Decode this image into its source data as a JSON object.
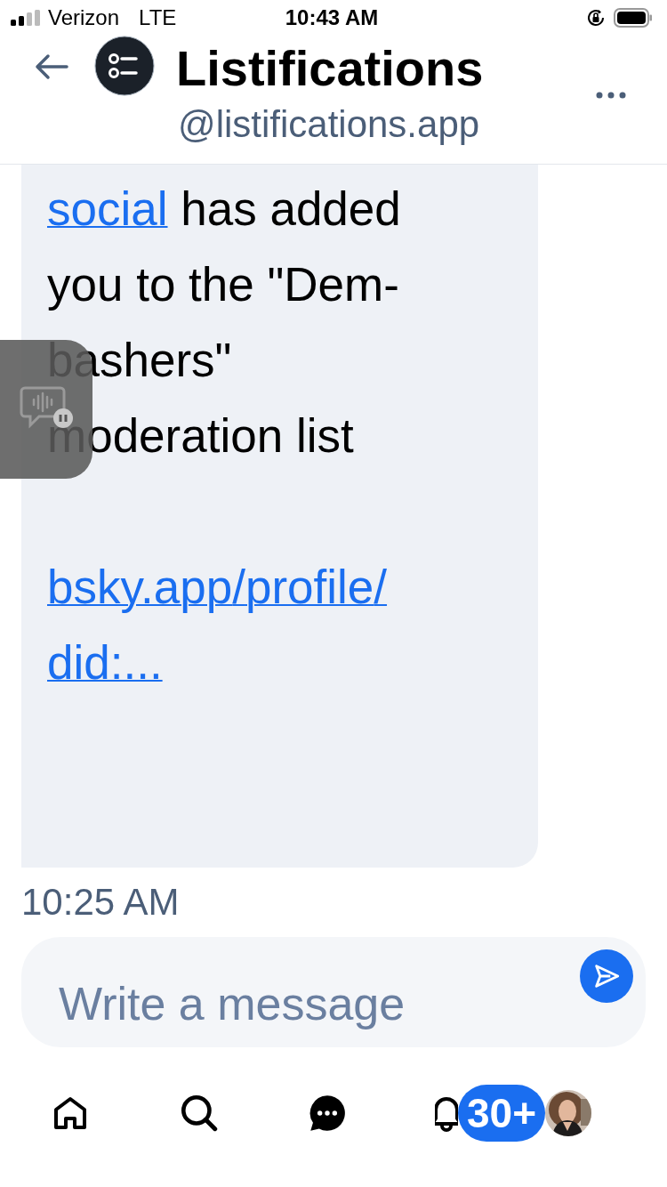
{
  "status_bar": {
    "carrier": "Verizon",
    "network": "LTE",
    "time": "10:43 AM"
  },
  "header": {
    "title": "Listifications",
    "handle": "@listifications.app"
  },
  "message": {
    "parts": [
      {
        "kind": "link",
        "text": "social"
      },
      {
        "kind": "text",
        "text": " has added you to the \"Dem-bashers\" moderation list"
      }
    ],
    "link": "bsky.app/profile/did:...",
    "time": "10:25 AM"
  },
  "composer": {
    "placeholder": "Write a message"
  },
  "nav": [
    {
      "kind": "home"
    },
    {
      "kind": "search"
    },
    {
      "kind": "chat"
    },
    {
      "kind": "bell",
      "badge": "30+"
    },
    {
      "kind": "avatar"
    }
  ]
}
